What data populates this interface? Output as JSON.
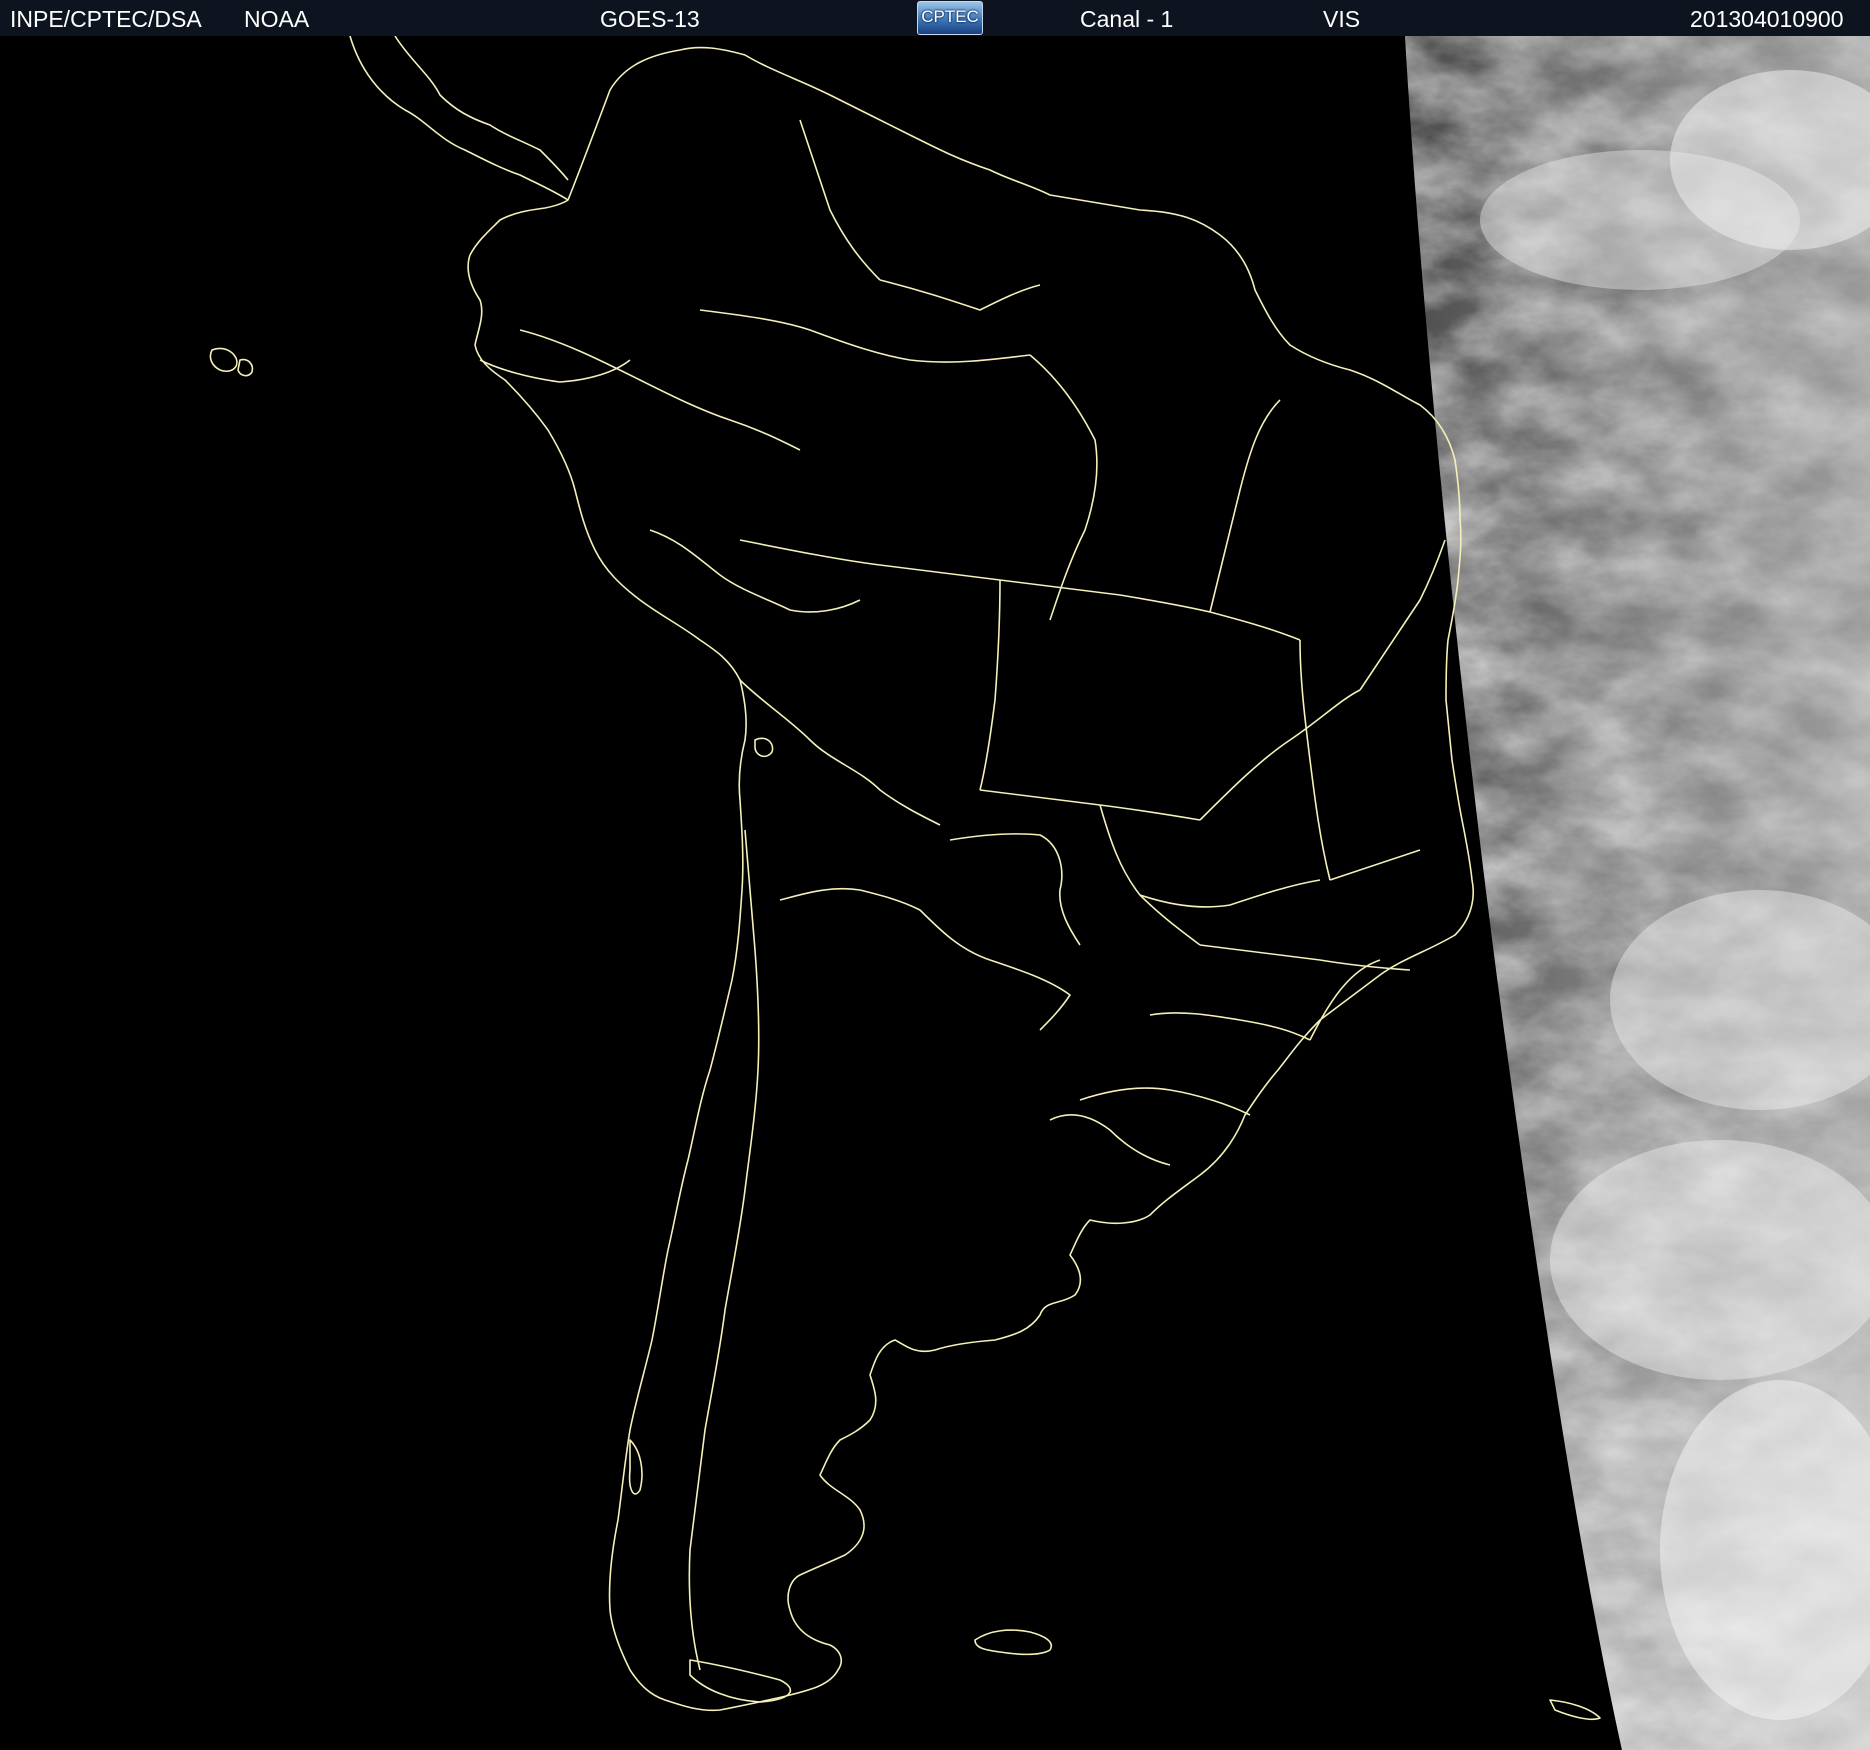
{
  "header": {
    "institution": "INPE/CPTEC/DSA",
    "agency": "NOAA",
    "satellite": "GOES-13",
    "logo_text": "CPTEC",
    "channel": "Canal - 1",
    "band": "VIS",
    "datetime": "201304010900"
  },
  "map": {
    "view": "satellite-image",
    "region": "South America",
    "border_color": "#f4f0b8",
    "night_color": "#000000",
    "cloud_tint": "#9a9a9a"
  }
}
